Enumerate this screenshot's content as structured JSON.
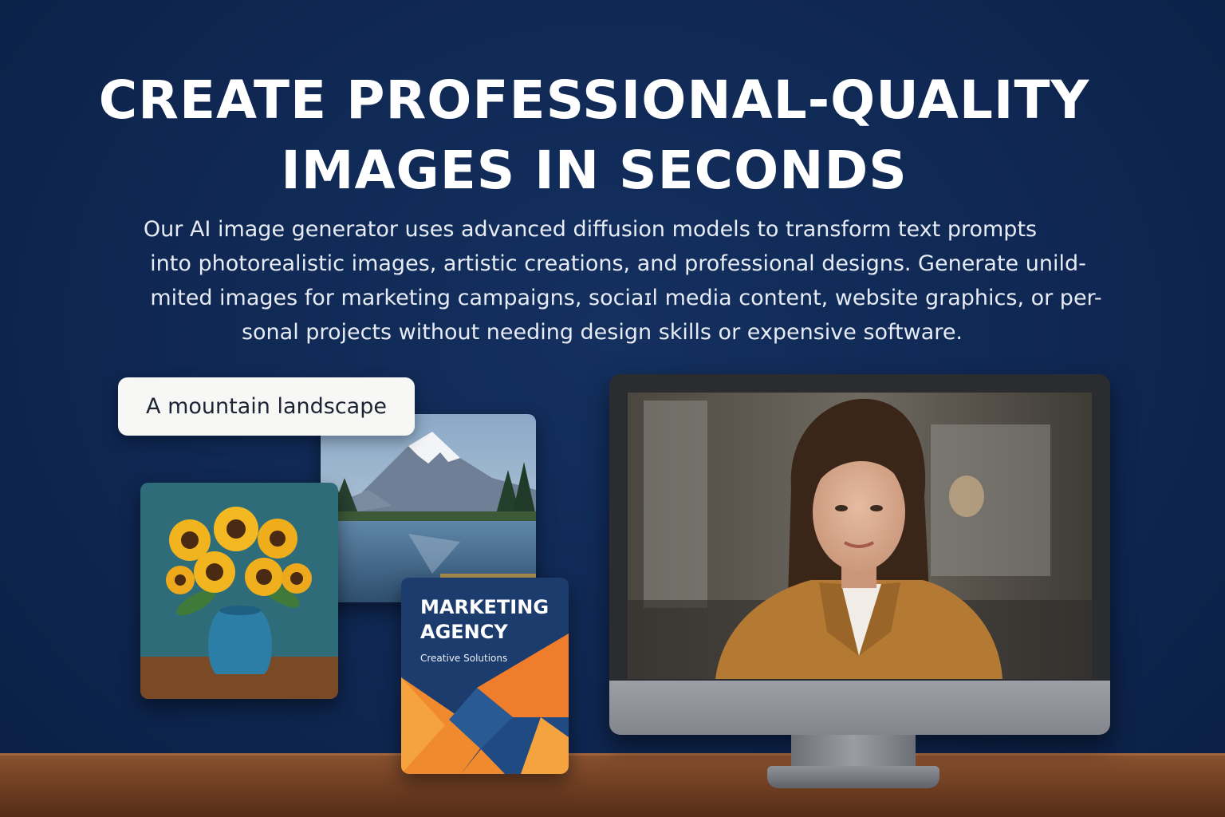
{
  "hero": {
    "headline_line1": "CREATE PROFESSIONAL-QUALITY",
    "headline_line2": "IMAGES IN SECONDS",
    "description_lines": [
      "Our AI image generator uses advanced diffusion models to transform text prompts",
      "into photorealistic images, artistic creations, and professional designs. Generate unild-",
      "mited images for marketing campaigns, sociaɪl media content, website graphics, or per-",
      "sonal projects without needing design skills or expensive software."
    ]
  },
  "prompt_example": {
    "text": "A mountain landscape"
  },
  "sample_cards": {
    "agency_title_line1": "MARKETING",
    "agency_title_line2": "AGENCY",
    "agency_subtitle": "Creative Solutions"
  },
  "colors": {
    "background": "#0f2752",
    "accent_orange": "#ef7d2c",
    "agency_navy": "#1d3c6e",
    "desk_wood": "#7a4528"
  }
}
